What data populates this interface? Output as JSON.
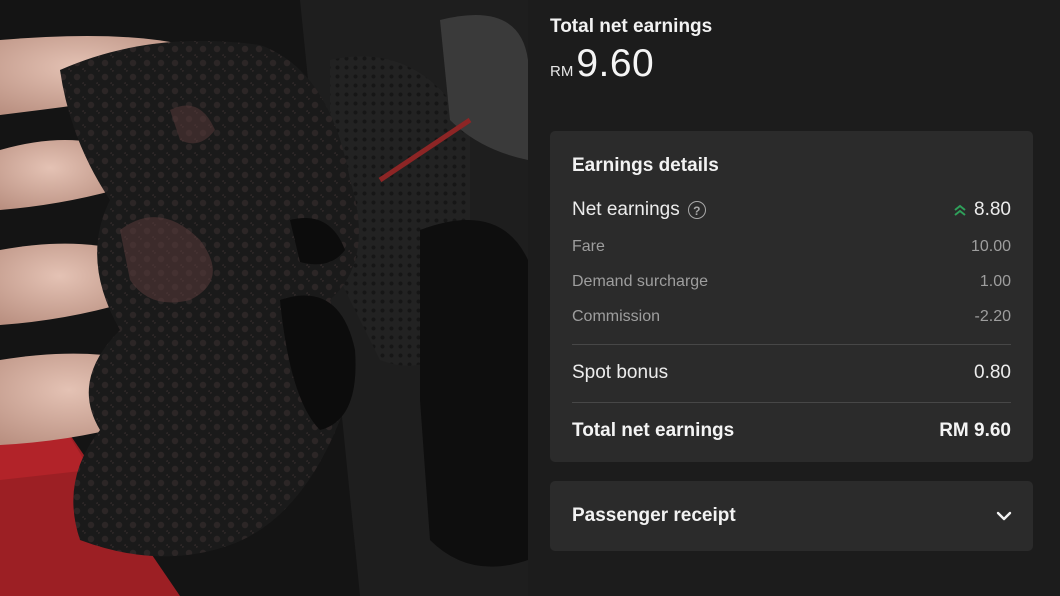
{
  "summary": {
    "title": "Total net earnings",
    "currency": "RM",
    "amount": "9.60"
  },
  "earnings_details": {
    "title": "Earnings details",
    "net_earnings": {
      "label": "Net earnings",
      "value": "8.80",
      "icon": "double-chevron-up-icon",
      "icon_color": "#2fa05a"
    },
    "breakdown": [
      {
        "label": "Fare",
        "value": "10.00"
      },
      {
        "label": "Demand surcharge",
        "value": "1.00"
      },
      {
        "label": "Commission",
        "value": "-2.20"
      }
    ],
    "spot_bonus": {
      "label": "Spot bonus",
      "value": "0.80"
    },
    "total": {
      "label": "Total net earnings",
      "value": "RM 9.60"
    }
  },
  "passenger_receipt": {
    "label": "Passenger receipt",
    "icon": "chevron-down-icon"
  },
  "colors": {
    "background": "#1c1c1c",
    "card": "#2b2b2b",
    "accent_green": "#2fa05a"
  }
}
